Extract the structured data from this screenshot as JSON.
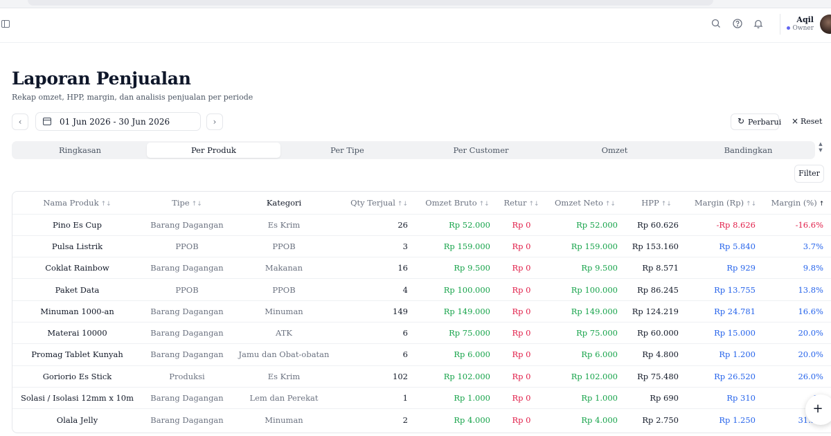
{
  "header": {
    "user_name": "Aqil",
    "user_role": "Owner"
  },
  "page": {
    "title": "Laporan Penjualan",
    "subtitle": "Rekap omzet, HPP, margin, dan analisis penjualan per periode"
  },
  "date_range": "01 Jun 2026 - 30 Jun 2026",
  "actions": {
    "refresh_label": "Perbarui",
    "reset_label": "Reset",
    "filter_label": "Filter"
  },
  "tabs": [
    "Ringkasan",
    "Per Produk",
    "Per Tipe",
    "Per Customer",
    "Omzet",
    "Bandingkan"
  ],
  "active_tab": "Per Produk",
  "table": {
    "columns": [
      "Nama Produk",
      "Tipe",
      "Kategori",
      "Qty Terjual",
      "Omzet Bruto",
      "Retur",
      "Omzet Neto",
      "HPP",
      "Margin (Rp)",
      "Margin (%)"
    ],
    "sort_column": "Margin (%)",
    "sort_direction": "asc",
    "rows": [
      {
        "nama": "Pino Es Cup",
        "tipe": "Barang Dagangan",
        "kategori": "Es Krim",
        "qty": "26",
        "bruto": "Rp 52.000",
        "retur": "Rp 0",
        "neto": "Rp 52.000",
        "hpp": "Rp 60.626",
        "margin_rp": "-Rp 8.626",
        "margin_pct": "-16.6%"
      },
      {
        "nama": "Pulsa Listrik",
        "tipe": "PPOB",
        "kategori": "PPOB",
        "qty": "3",
        "bruto": "Rp 159.000",
        "retur": "Rp 0",
        "neto": "Rp 159.000",
        "hpp": "Rp 153.160",
        "margin_rp": "Rp 5.840",
        "margin_pct": "3.7%"
      },
      {
        "nama": "Coklat Rainbow",
        "tipe": "Barang Dagangan",
        "kategori": "Makanan",
        "qty": "16",
        "bruto": "Rp 9.500",
        "retur": "Rp 0",
        "neto": "Rp 9.500",
        "hpp": "Rp 8.571",
        "margin_rp": "Rp 929",
        "margin_pct": "9.8%"
      },
      {
        "nama": "Paket Data",
        "tipe": "PPOB",
        "kategori": "PPOB",
        "qty": "4",
        "bruto": "Rp 100.000",
        "retur": "Rp 0",
        "neto": "Rp 100.000",
        "hpp": "Rp 86.245",
        "margin_rp": "Rp 13.755",
        "margin_pct": "13.8%"
      },
      {
        "nama": "Minuman 1000-an",
        "tipe": "Barang Dagangan",
        "kategori": "Minuman",
        "qty": "149",
        "bruto": "Rp 149.000",
        "retur": "Rp 0",
        "neto": "Rp 149.000",
        "hpp": "Rp 124.219",
        "margin_rp": "Rp 24.781",
        "margin_pct": "16.6%"
      },
      {
        "nama": "Materai 10000",
        "tipe": "Barang Dagangan",
        "kategori": "ATK",
        "qty": "6",
        "bruto": "Rp 75.000",
        "retur": "Rp 0",
        "neto": "Rp 75.000",
        "hpp": "Rp 60.000",
        "margin_rp": "Rp 15.000",
        "margin_pct": "20.0%"
      },
      {
        "nama": "Promag Tablet Kunyah",
        "tipe": "Barang Dagangan",
        "kategori": "Jamu dan Obat-obatan",
        "qty": "6",
        "bruto": "Rp 6.000",
        "retur": "Rp 0",
        "neto": "Rp 6.000",
        "hpp": "Rp 4.800",
        "margin_rp": "Rp 1.200",
        "margin_pct": "20.0%"
      },
      {
        "nama": "Goriorio Es Stick",
        "tipe": "Produksi",
        "kategori": "Es Krim",
        "qty": "102",
        "bruto": "Rp 102.000",
        "retur": "Rp 0",
        "neto": "Rp 102.000",
        "hpp": "Rp 75.480",
        "margin_rp": "Rp 26.520",
        "margin_pct": "26.0%"
      },
      {
        "nama": "Solasi / Isolasi 12mm x 10m",
        "tipe": "Barang Dagangan",
        "kategori": "Lem dan Perekat",
        "qty": "1",
        "bruto": "Rp 1.000",
        "retur": "Rp 0",
        "neto": "Rp 1.000",
        "hpp": "Rp 690",
        "margin_rp": "Rp 310",
        "margin_pct": "31"
      },
      {
        "nama": "Olala Jelly",
        "tipe": "Barang Dagangan",
        "kategori": "Minuman",
        "qty": "2",
        "bruto": "Rp 4.000",
        "retur": "Rp 0",
        "neto": "Rp 4.000",
        "hpp": "Rp 2.750",
        "margin_rp": "Rp 1.250",
        "margin_pct": "31.3%"
      }
    ]
  },
  "colors": {
    "positive": "#16a34a",
    "negative": "#e11d48",
    "margin": "#2563eb",
    "accent": "#6366f1"
  },
  "icons": [
    "sidebar-toggle-icon",
    "search-icon",
    "help-icon",
    "bell-icon",
    "calendar-icon",
    "chevron-left-icon",
    "chevron-right-icon",
    "refresh-icon",
    "close-icon",
    "sort-icon",
    "sort-asc-icon",
    "plus-icon"
  ]
}
